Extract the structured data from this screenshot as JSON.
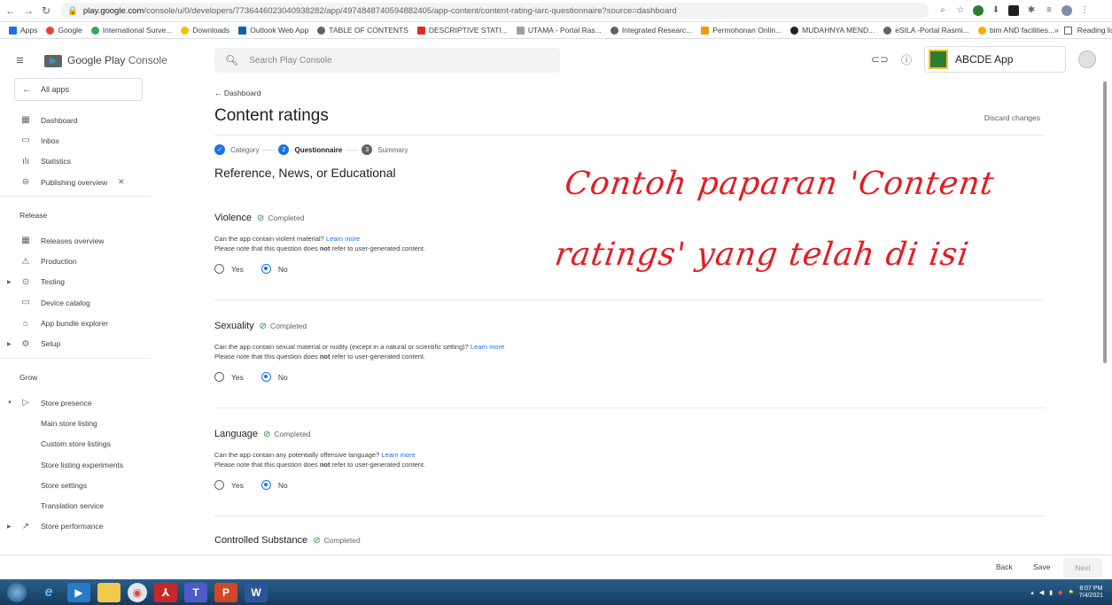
{
  "browser": {
    "url_host": "play.google.com",
    "url_path": "/console/u/0/developers/7736446023040938282/app/4974848740594882405/app-content/content-rating-iarc-questionnaire?source=dashboard",
    "bookmarks": [
      "Apps",
      "Google",
      "International Surve...",
      "Downloads",
      "Outlook Web App",
      "TABLE OF CONTENTS",
      "DESCRIPTIVE STATI...",
      "UTAMA - Portal Ras...",
      "Integrated Researc...",
      "Permohonan Onlin...",
      "MUDAHNYA MEND...",
      "eSILA -Portal Rasmi...",
      "bim AND facilities..."
    ],
    "more_bookmarks": "»",
    "reading_list": "Reading list"
  },
  "header": {
    "logo_google": "Google Play",
    "logo_console": "Console",
    "search_placeholder": "Search Play Console",
    "app_name": "ABCDE App"
  },
  "sidebar": {
    "all_apps": "All apps",
    "top_items": [
      "Dashboard",
      "Inbox",
      "Statistics",
      "Publishing overview"
    ],
    "release_title": "Release",
    "release_items": [
      "Releases overview",
      "Production",
      "Testing",
      "Device catalog",
      "App bundle explorer",
      "Setup"
    ],
    "grow_title": "Grow",
    "store_presence": "Store presence",
    "store_presence_sub": [
      "Main store listing",
      "Custom store listings",
      "Store listing experiments",
      "Store settings",
      "Translation service"
    ],
    "store_performance": "Store performance"
  },
  "main": {
    "back": "Dashboard",
    "title": "Content ratings",
    "discard": "Discard changes",
    "steps": [
      {
        "num": "",
        "label": "Category",
        "state": "done"
      },
      {
        "num": "2",
        "label": "Questionnaire",
        "state": "active"
      },
      {
        "num": "3",
        "label": "Summary",
        "state": "todo"
      }
    ],
    "subtitle": "Reference, News, or Educational",
    "questions": [
      {
        "title": "Violence",
        "status": "Completed",
        "text": "Can the app contain violent material?",
        "link": "Learn more",
        "note_pre": "Please note that this question does ",
        "note_bold": "not",
        "note_post": " refer to user-generated content.",
        "yes": "Yes",
        "no": "No"
      },
      {
        "title": "Sexuality",
        "status": "Completed",
        "text": "Can the app contain sexual material or nudity (except in a natural or scientific setting)?",
        "link": "Learn more",
        "note_pre": "Please note that this question does ",
        "note_bold": "not",
        "note_post": " refer to user-generated content.",
        "yes": "Yes",
        "no": "No"
      },
      {
        "title": "Language",
        "status": "Completed",
        "text": "Can the app contain any potentially offensive language?",
        "link": "Learn more",
        "note_pre": "Please note that this question does ",
        "note_bold": "not",
        "note_post": " refer to user-generated content.",
        "yes": "Yes",
        "no": "No"
      },
      {
        "title": "Controlled Substance",
        "status": "Completed"
      }
    ]
  },
  "overlay": {
    "line1": "Contoh paparan 'Content",
    "line2": "ratings' yang telah di isi"
  },
  "actions": {
    "back": "Back",
    "save": "Save",
    "next": "Next"
  },
  "taskbar": {
    "time": "8:07 PM",
    "date": "7/4/2021"
  },
  "colors": {
    "accent": "#1a73e8",
    "completed": "#1e8e3e",
    "overlay": "#e51c23"
  }
}
